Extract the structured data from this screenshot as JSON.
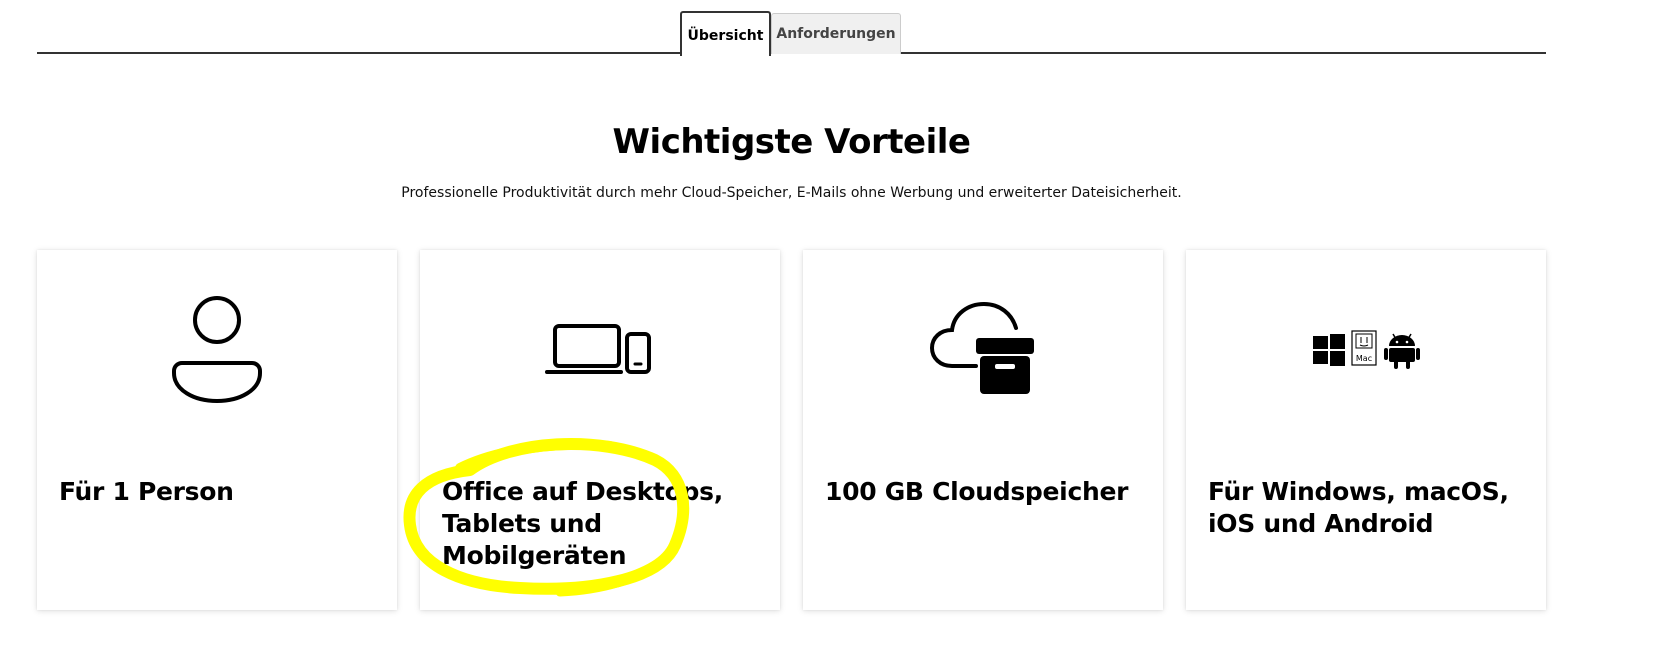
{
  "tabs": [
    {
      "label": "Übersicht",
      "active": true
    },
    {
      "label": "Anforderungen",
      "active": false
    }
  ],
  "benefits": {
    "title": "Wichtigste Vorteile",
    "subtitle": "Professionelle Produktivität durch mehr Cloud-Speicher, E-Mails ohne Werbung und erweiterter Dateisicherheit."
  },
  "cards": [
    {
      "icon": "person-icon",
      "title": "Für 1 Person"
    },
    {
      "icon": "laptop-phone-icon",
      "title": "Office auf Desktops, Tablets und Mobilgeräten"
    },
    {
      "icon": "cloud-archive-icon",
      "title": "100 GB Cloudspeicher"
    },
    {
      "icon": "platforms-icon",
      "title": "Für Windows, macOS, iOS und Android",
      "icon_text": "Mac"
    }
  ],
  "annotation": {
    "color": "#ffff00",
    "target": "card-1"
  }
}
